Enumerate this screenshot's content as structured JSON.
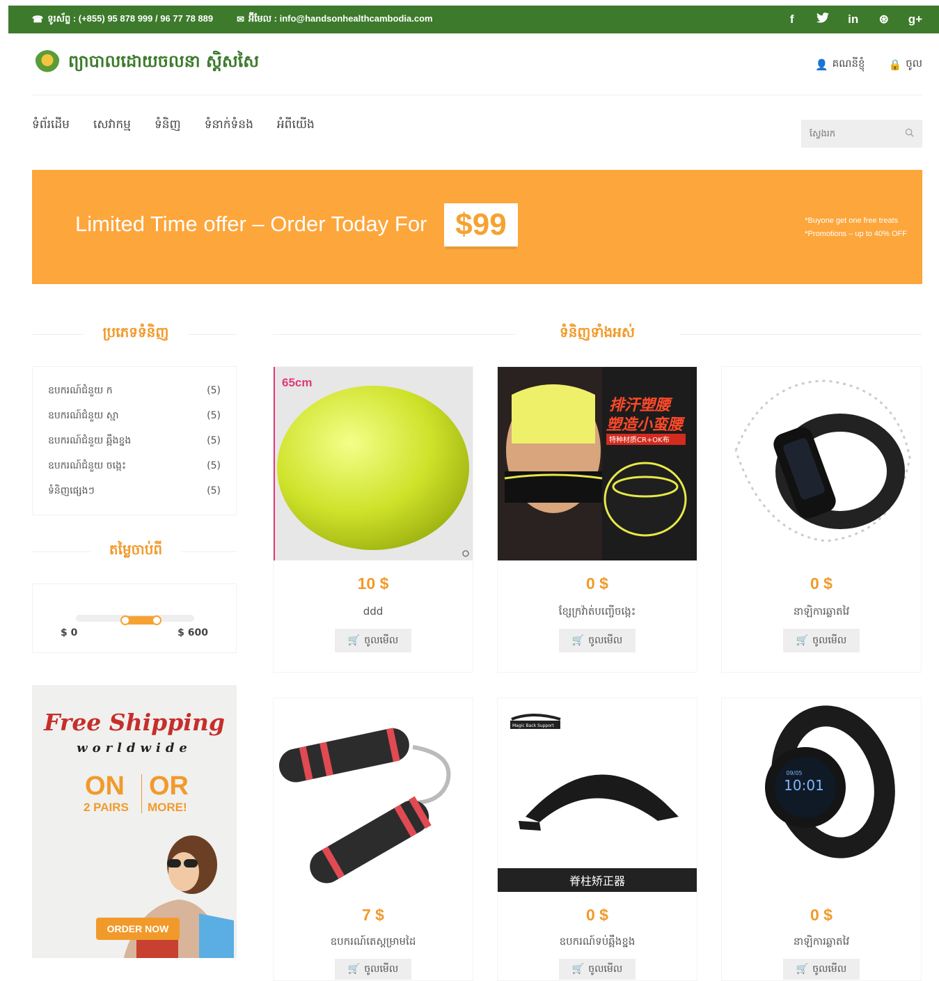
{
  "topbar": {
    "phone": "ទូរស័ព្ទ : (+855) 95 878 999 / 96 77 78 889",
    "email": "អ៊ីមែល : info@handsonhealthcambodia.com",
    "social": {
      "facebook": "f",
      "twitter": "🐦",
      "linkedin": "in",
      "dribbble": "⊛",
      "googleplus": "g+"
    }
  },
  "header": {
    "site_name": "ព្យាបាលដោយចលនា ស្តិសសៃ",
    "account_label": "គណនីខ្ញុំ",
    "login_label": "ចូល"
  },
  "nav": {
    "items": [
      "ទំព័រដើម",
      "សេវាកម្ម",
      "ទំនិញ",
      "ទំនាក់ទំនង",
      "អំពីយើង"
    ],
    "search_placeholder": "ស្វែងរក"
  },
  "banner": {
    "headline": "Limited Time offer – Order Today For",
    "price": "$99",
    "promo_line1": "*Buyone get one free treats",
    "promo_line2": "*Promotions – up to 40% OFF"
  },
  "sidebar": {
    "categories_title": "ប្រភេទទំនិញ",
    "categories": [
      {
        "name": "ឧបករណ៍ជំនួយ ក",
        "count": "(5)"
      },
      {
        "name": "ឧបករណ៍ជំនួយ ស្មា",
        "count": "(5)"
      },
      {
        "name": "ឧបករណ៍ជំនួយ ឆ្អឹងខ្នង",
        "count": "(5)"
      },
      {
        "name": "ឧបករណ៍ជំនួយ ចង្កេះ",
        "count": "(5)"
      },
      {
        "name": "ទំនិញផ្សេងៗ",
        "count": "(5)"
      }
    ],
    "price_title": "តម្លៃចាប់ពី",
    "price_min": "$ 0",
    "price_max": "$ 600",
    "price_range_fraction": [
      0.4,
      0.7
    ]
  },
  "ad": {
    "free_shipping": "Free Shipping",
    "worldwide": "worldwide",
    "on": "ON",
    "or": "OR",
    "pairs": "2 PAIRS",
    "more": "MORE!",
    "order_now": "ORDER NOW"
  },
  "products": {
    "title": "ទំនិញទាំងអស់",
    "view_label": "ចូលមើល",
    "ball_label": "65cm",
    "belt_text1": "排汗塑腰",
    "belt_text2": "塑造小蛮腰",
    "belt_text3": "特种材质CR+OK布",
    "back_support_caption": "脊柱矫正器",
    "back_support_brand": "Magic Back Support",
    "watch_time": "10:01",
    "watch_date": "09/05",
    "items": [
      {
        "price": "10 $",
        "name": "ddd"
      },
      {
        "price": "0 $",
        "name": "ខ្សែក្រវ៉ាត់បញ្ចើចង្កេះ"
      },
      {
        "price": "0 $",
        "name": "នាឡិការឆ្លាតវៃ"
      },
      {
        "price": "7 $",
        "name": "ឧបករណ៍តេស្តម្រាមដៃ"
      },
      {
        "price": "0 $",
        "name": "ឧបករណ៍ទប់ឆ្អឹងខ្នង"
      },
      {
        "price": "0 $",
        "name": "នាឡិការឆ្លាតវៃ"
      }
    ]
  },
  "colors": {
    "green": "#3d7a2c",
    "orange": "#f19a2b",
    "banner": "#fca63c"
  }
}
